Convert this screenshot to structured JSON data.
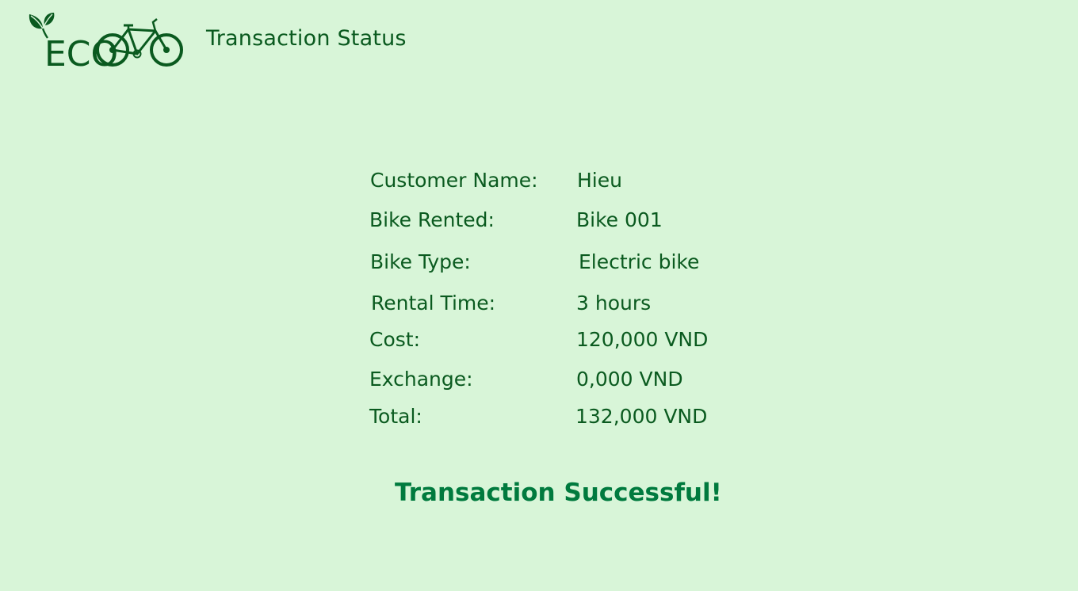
{
  "brand": {
    "logo_text": "ECO",
    "primary_color": "#0a5a1f",
    "success_color": "#007a3e",
    "background_color": "#d8f5d8"
  },
  "header": {
    "title": "Transaction Status"
  },
  "details": [
    {
      "label": "Customer Name:",
      "value": "Hieu"
    },
    {
      "label": "Bike Rented:",
      "value": "Bike 001"
    },
    {
      "label": "Bike Type:",
      "value": "Electric bike"
    },
    {
      "label": "Rental Time:",
      "value": "3 hours"
    },
    {
      "label": "Cost:",
      "value": "120,000 VND"
    },
    {
      "label": "Exchange:",
      "value": "0,000 VND"
    },
    {
      "label": "Total:",
      "value": "132,000 VND"
    }
  ],
  "status": {
    "message": "Transaction Successful!"
  }
}
